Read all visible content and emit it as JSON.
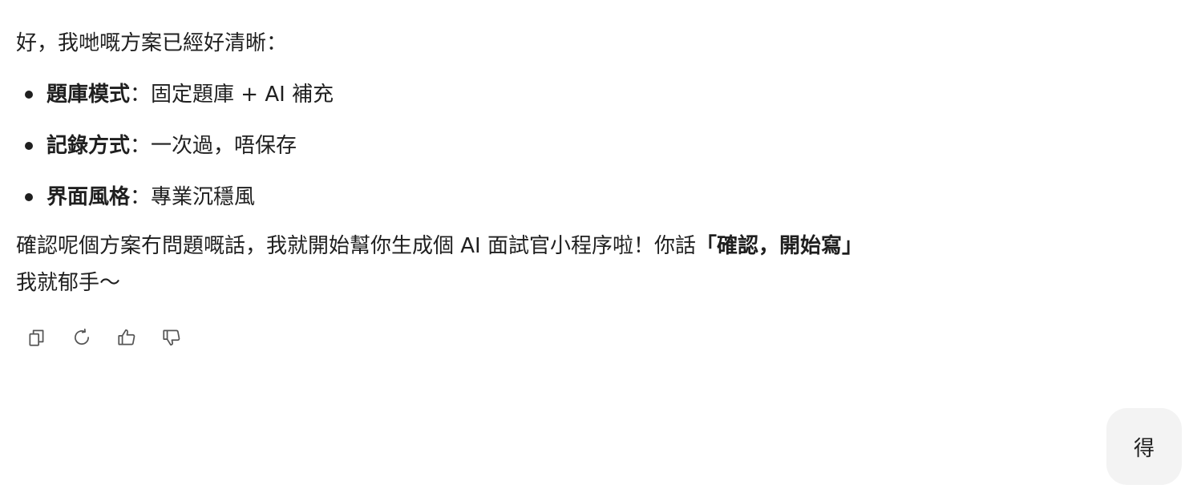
{
  "assistant_message": {
    "intro": "好，我哋嘅方案已經好清晰：",
    "bullets": [
      {
        "label": "題庫模式",
        "sep": "：",
        "value": "固定題庫 + AI 補充"
      },
      {
        "label": "記錄方式",
        "sep": "：",
        "value": "一次過，唔保存"
      },
      {
        "label": "界面風格",
        "sep": "：",
        "value": "專業沉穩風"
      }
    ],
    "closing_part1": "確認呢個方案冇問題嘅話，我就開始幫你生成個 AI 面試官小程序啦！你話",
    "closing_bold": "「確認，開始寫」",
    "closing_part2": "我就郁手～"
  },
  "actions": [
    {
      "name": "copy",
      "icon": "copy-icon"
    },
    {
      "name": "regenerate",
      "icon": "refresh-icon"
    },
    {
      "name": "like",
      "icon": "thumbs-up-icon"
    },
    {
      "name": "dislike",
      "icon": "thumbs-down-icon"
    }
  ],
  "user_message": {
    "text": "得"
  }
}
